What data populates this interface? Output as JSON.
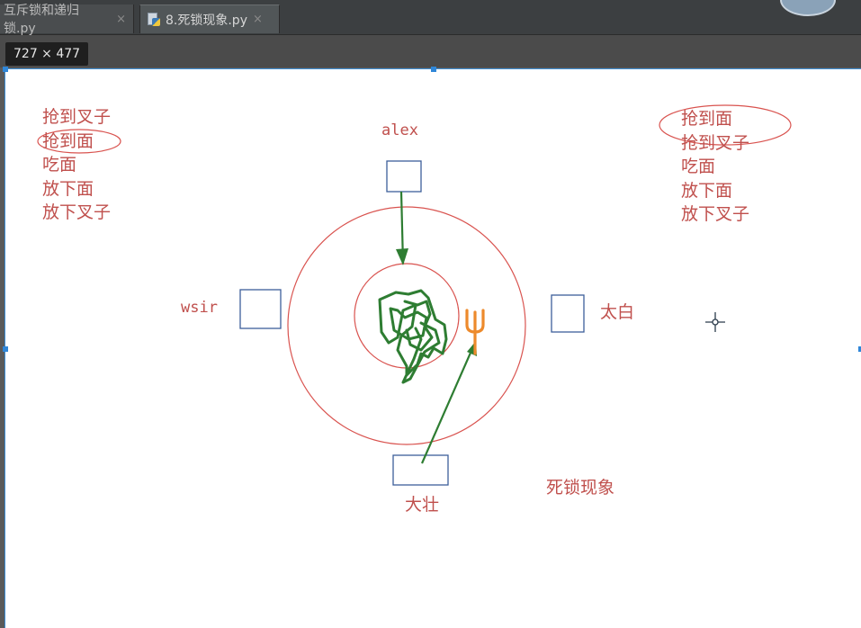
{
  "tabs": [
    {
      "label": "互斥锁和递归锁.py",
      "close": "×"
    },
    {
      "label": "8.死锁现象.py",
      "close": "×"
    }
  ],
  "size_badge": "727 × 477",
  "drawing": {
    "left_list": [
      "抢到叉子",
      "抢到面",
      "吃面",
      "放下面",
      "放下叉子"
    ],
    "right_list": [
      "抢到面",
      "抢到叉子",
      "吃面",
      "放下面",
      "放下叉子"
    ],
    "name_top": "alex",
    "name_left": "wsir",
    "name_right": "太白",
    "name_bottom": "大壮",
    "caption": "死锁现象"
  },
  "colors": {
    "ink_red": "#c0504d",
    "ink_green": "#2e7d32",
    "ink_orange": "#ed8a2c",
    "box_blue": "#3d5f9a",
    "selection_blue": "#2f86d8"
  }
}
